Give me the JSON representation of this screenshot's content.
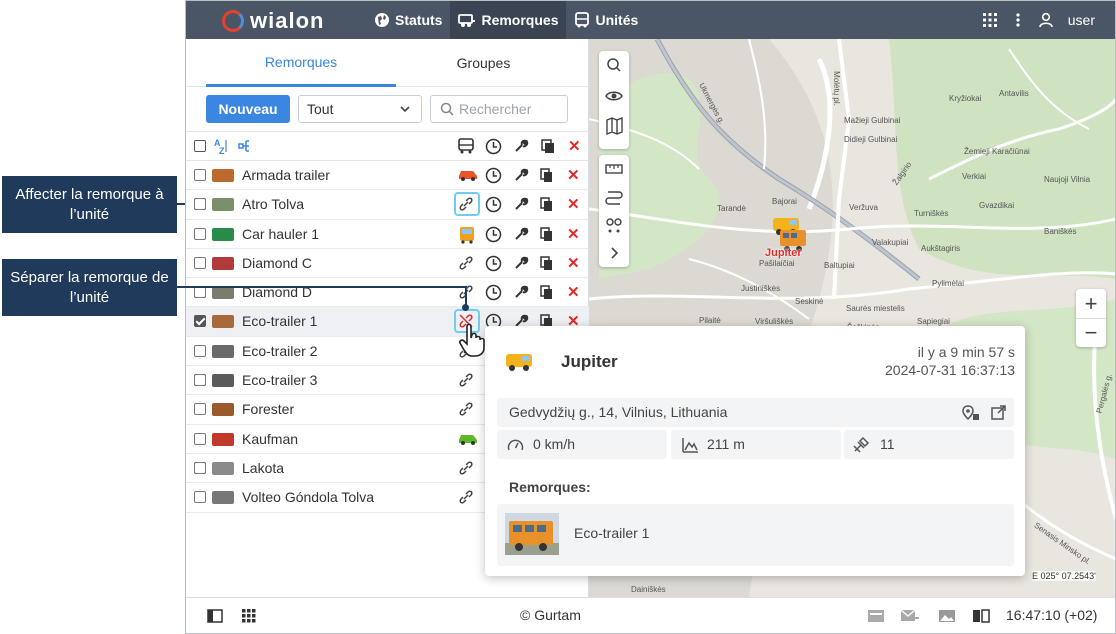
{
  "topbar": {
    "logo": "wialon",
    "nav": [
      {
        "label": "Statuts",
        "icon": "globe-icon"
      },
      {
        "label": "Remorques",
        "icon": "trailer-icon",
        "active": true
      },
      {
        "label": "Unités",
        "icon": "bus-icon"
      }
    ],
    "user": "user"
  },
  "tabs": [
    "Remorques",
    "Groupes"
  ],
  "toolbar": {
    "new_label": "Nouveau",
    "filter_value": "Tout",
    "search_placeholder": "Rechercher"
  },
  "trailers": [
    {
      "name": "Armada trailer",
      "assign": "car",
      "selected": false
    },
    {
      "name": "Atro Tolva",
      "assign": "link",
      "selected": false
    },
    {
      "name": "Car hauler 1",
      "assign": "bus",
      "selected": false
    },
    {
      "name": "Diamond C",
      "assign": "link",
      "selected": false
    },
    {
      "name": "Diamond D",
      "assign": "link",
      "selected": false
    },
    {
      "name": "Eco-trailer 1",
      "assign": "unlink",
      "selected": true
    },
    {
      "name": "Eco-trailer 2",
      "assign": "link",
      "selected": false
    },
    {
      "name": "Eco-trailer 3",
      "assign": "link",
      "selected": false
    },
    {
      "name": "Forester",
      "assign": "link",
      "selected": false
    },
    {
      "name": "Kaufman",
      "assign": "green-car",
      "selected": false
    },
    {
      "name": "Lakota",
      "assign": "link",
      "selected": false
    },
    {
      "name": "Volteo Góndola Tolva",
      "assign": "link",
      "selected": false
    }
  ],
  "callouts": {
    "assign": "Affecter  la remorque à l’unité",
    "detach": "Séparer la remorque de l’unité"
  },
  "map": {
    "unit_label": "Jupiter",
    "labels": [
      "Ukmergės g.",
      "Molėtų pl.",
      "Žalgirio",
      "Kryžiokai",
      "Antavilis",
      "Mažieji Gulbinai",
      "Didieji Gulbinai",
      "Žemieji Karačiūnai",
      "Verkiai",
      "Naujoji Vilnia",
      "Bajorai",
      "Tarandė",
      "Veržuva",
      "Turniškės",
      "Gvazdikai",
      "Baniškės",
      "Pašilaičiai",
      "Baltupiai",
      "Valakupiai",
      "Aukštagiris",
      "Justiniškės",
      "Pylimėlai",
      "Seskinė",
      "Saurės miestelis",
      "Pilaitė",
      "Viršuliškės",
      "Šeškinės",
      "Sapiegiai",
      "Dainiškės",
      "Senasis Minsko pl.",
      "Pergalės g.",
      "E 025° 07.2543'"
    ]
  },
  "popup": {
    "unit": "Jupiter",
    "ago": "il y a 9 min 57 s",
    "datetime": "2024-07-31 16:37:13",
    "address": "Gedvydžių g., 14, Vilnius, Lithuania",
    "speed": "0 km/h",
    "altitude": "211 m",
    "satellites": "11",
    "trailers_label": "Remorques:",
    "trailer_name": "Eco-trailer 1"
  },
  "bottom": {
    "copyright": "© Gurtam",
    "time": "16:47:10 (+02)"
  }
}
